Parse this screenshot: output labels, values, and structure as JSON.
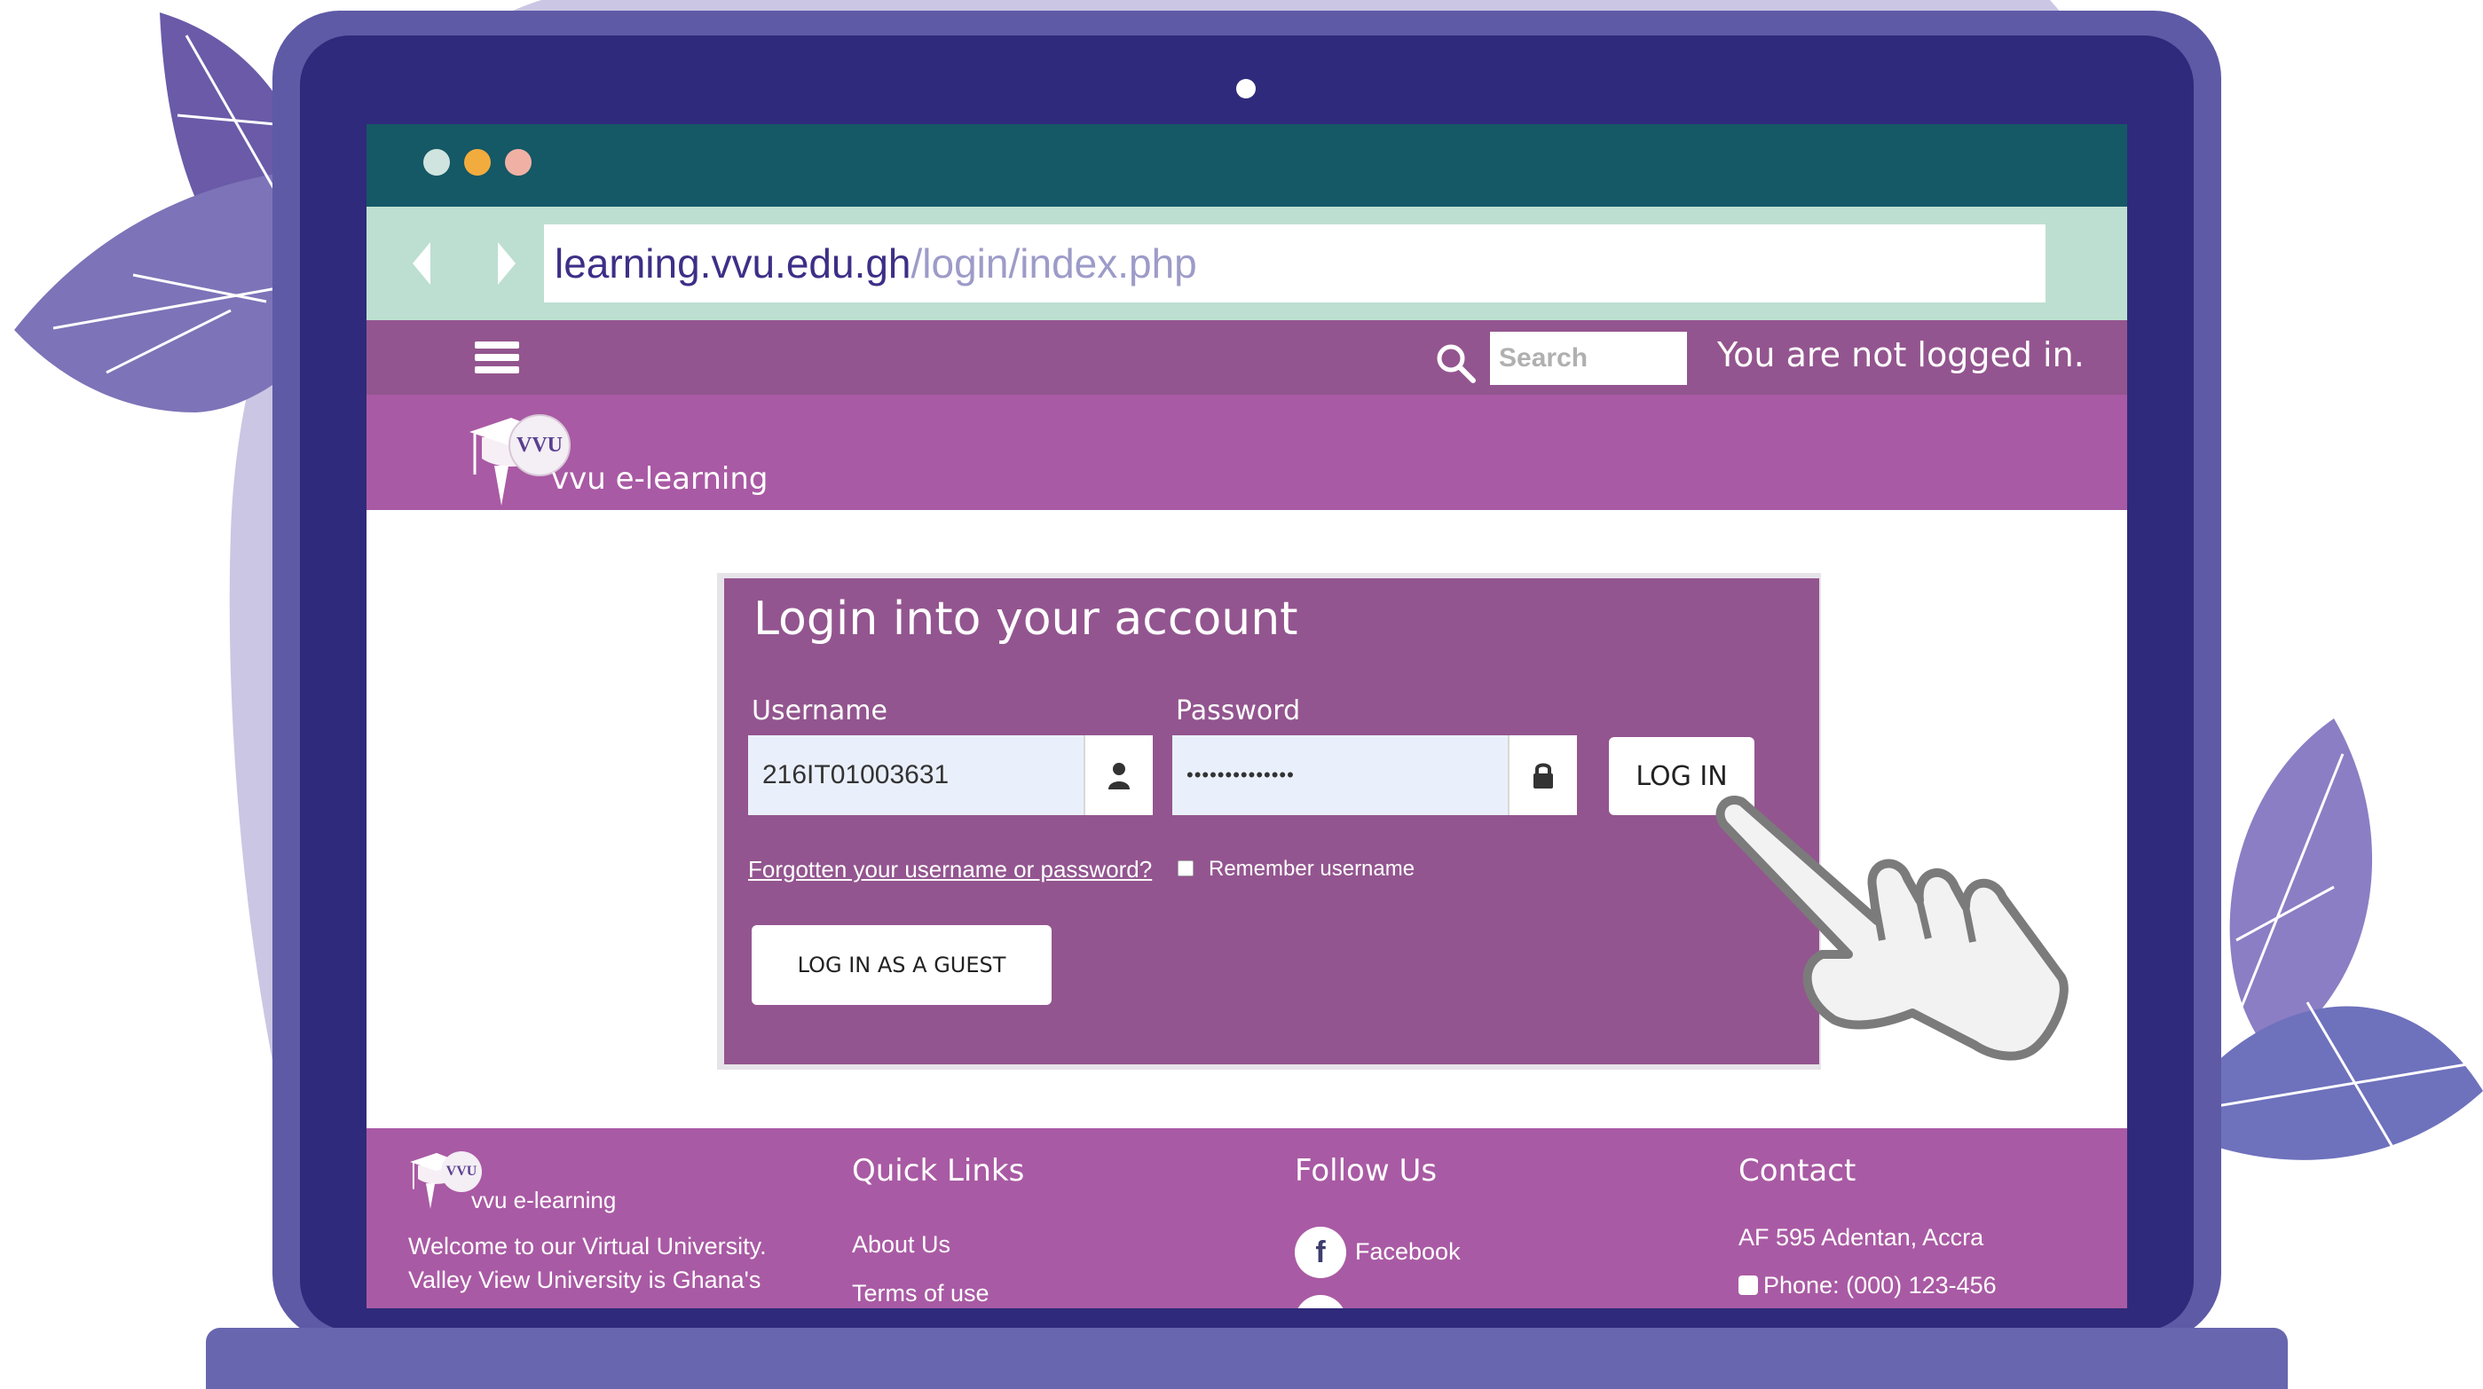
{
  "window": {
    "traffic_light_colors": [
      "#cfe4de",
      "#f2ac3e",
      "#f0b1a4"
    ]
  },
  "address_bar": {
    "url_host": "learning.vvu.edu.gh",
    "url_path": "/login/index.php"
  },
  "top_nav": {
    "search_placeholder": "Search",
    "login_status": "You are not logged in."
  },
  "brand": {
    "logo_badge": "VVU",
    "name": "vvu e-learning"
  },
  "login": {
    "title": "Login into your account",
    "username_label": "Username",
    "username_value": "216IT01003631",
    "password_label": "Password",
    "password_value": "••••••••••••••",
    "login_button": "LOG IN",
    "forgot_link": "Forgotten your username or password?",
    "remember_label": "Remember username",
    "guest_button": "LOG IN AS A GUEST"
  },
  "footer": {
    "logo_badge": "VVU",
    "brand_name": "vvu e-learning",
    "about_line1": "Welcome to our Virtual University.",
    "about_line2": "Valley View University is Ghana's",
    "quick_links_title": "Quick Links",
    "quick_links": [
      "About Us",
      "Terms of use"
    ],
    "follow_title": "Follow Us",
    "facebook_label": "Facebook",
    "contact_title": "Contact",
    "address": "AF 595 Adentan, Accra",
    "phone": "Phone: (000) 123-456"
  },
  "colors": {
    "titlebar": "#155866",
    "addressbar": "#bddfd1",
    "nav": "#93558f",
    "brandbar": "#a95aa4",
    "laptop_bezel": "#2f2a7b",
    "laptop_frame": "#5e5aa6"
  }
}
